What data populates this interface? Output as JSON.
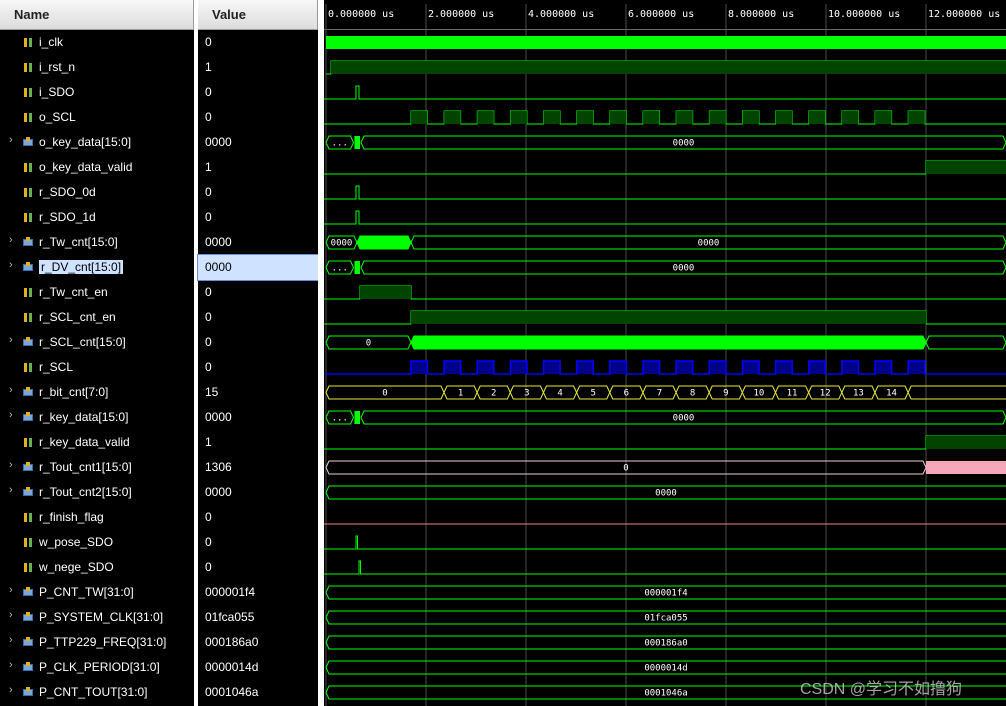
{
  "headers": {
    "name": "Name",
    "value": "Value"
  },
  "signals": [
    {
      "name": "i_clk",
      "value": "0",
      "type": "sig",
      "expand": false
    },
    {
      "name": "i_rst_n",
      "value": "1",
      "type": "sig",
      "expand": false
    },
    {
      "name": "i_SDO",
      "value": "0",
      "type": "sig",
      "expand": false
    },
    {
      "name": "o_SCL",
      "value": "0",
      "type": "sig",
      "expand": false
    },
    {
      "name": "o_key_data[15:0]",
      "value": "0000",
      "type": "bus",
      "expand": true
    },
    {
      "name": "o_key_data_valid",
      "value": "1",
      "type": "sig",
      "expand": false
    },
    {
      "name": "r_SDO_0d",
      "value": "0",
      "type": "sig",
      "expand": false
    },
    {
      "name": "r_SDO_1d",
      "value": "0",
      "type": "sig",
      "expand": false
    },
    {
      "name": "r_Tw_cnt[15:0]",
      "value": "0000",
      "type": "bus",
      "expand": true
    },
    {
      "name": "r_DV_cnt[15:0]",
      "value": "0000",
      "type": "bus",
      "expand": true,
      "selected": true
    },
    {
      "name": "r_Tw_cnt_en",
      "value": "0",
      "type": "sig",
      "expand": false
    },
    {
      "name": "r_SCL_cnt_en",
      "value": "0",
      "type": "sig",
      "expand": false
    },
    {
      "name": "r_SCL_cnt[15:0]",
      "value": "0",
      "type": "bus",
      "expand": true
    },
    {
      "name": "r_SCL",
      "value": "0",
      "type": "sig",
      "expand": false
    },
    {
      "name": "r_bit_cnt[7:0]",
      "value": "15",
      "type": "bus",
      "expand": true
    },
    {
      "name": "r_key_data[15:0]",
      "value": "0000",
      "type": "bus",
      "expand": true
    },
    {
      "name": "r_key_data_valid",
      "value": "1",
      "type": "sig",
      "expand": false
    },
    {
      "name": "r_Tout_cnt1[15:0]",
      "value": "1306",
      "type": "bus",
      "expand": true
    },
    {
      "name": "r_Tout_cnt2[15:0]",
      "value": "0000",
      "type": "bus",
      "expand": true
    },
    {
      "name": "r_finish_flag",
      "value": "0",
      "type": "sig",
      "expand": false
    },
    {
      "name": "w_pose_SDO",
      "value": "0",
      "type": "sig",
      "expand": false
    },
    {
      "name": "w_nege_SDO",
      "value": "0",
      "type": "sig",
      "expand": false
    },
    {
      "name": "P_CNT_TW[31:0]",
      "value": "000001f4",
      "type": "bus",
      "expand": true
    },
    {
      "name": "P_SYSTEM_CLK[31:0]",
      "value": "01fca055",
      "type": "bus",
      "expand": true
    },
    {
      "name": "P_TTP229_FREQ[31:0]",
      "value": "000186a0",
      "type": "bus",
      "expand": true
    },
    {
      "name": "P_CLK_PERIOD[31:0]",
      "value": "0000014d",
      "type": "bus",
      "expand": true
    },
    {
      "name": "P_CNT_TOUT[31:0]",
      "value": "0001046a",
      "type": "bus",
      "expand": true
    }
  ],
  "time_axis": {
    "unit": "us",
    "labels": [
      "0.000000 us",
      "2.000000 us",
      "4.000000 us",
      "6.000000 us",
      "8.000000 us",
      "10.000000 us",
      "12.000000 us"
    ],
    "view_end_us": 13.6
  },
  "waves": {
    "o_key_data_bus": {
      "segs": [
        {
          "t0": 0,
          "t1": 0.55,
          "v": "..."
        },
        {
          "t0": 0.7,
          "t1": 13.6,
          "v": "0000"
        }
      ],
      "pulse": [
        0.55,
        0.7
      ]
    },
    "r_Tw_cnt_bus": {
      "segs": [
        {
          "t0": 0,
          "t1": 0.62,
          "v": "0000"
        },
        {
          "t0": 1.7,
          "t1": 13.6,
          "v": "0000"
        }
      ],
      "fill": [
        0.62,
        1.7
      ]
    },
    "r_DV_cnt_bus": {
      "segs": [
        {
          "t0": 0,
          "t1": 0.55,
          "v": "..."
        },
        {
          "t0": 0.7,
          "t1": 13.6,
          "v": "0000"
        }
      ],
      "pulse": [
        0.55,
        0.7
      ]
    },
    "r_SCL_cnt_bus": {
      "segs": [
        {
          "t0": 0,
          "t1": 1.7,
          "v": "0"
        },
        {
          "t0": 12.0,
          "t1": 13.6,
          "v": ""
        }
      ],
      "fill": [
        1.7,
        12.0
      ]
    },
    "r_bit_cnt_bus": [
      "0",
      "1",
      "2",
      "3",
      "4",
      "5",
      "6",
      "7",
      "8",
      "9",
      "10",
      "11",
      "12",
      "13",
      "14"
    ],
    "r_key_data_bus": {
      "segs": [
        {
          "t0": 0,
          "t1": 0.55,
          "v": "..."
        },
        {
          "t0": 0.7,
          "t1": 13.6,
          "v": "0000"
        }
      ],
      "pulse": [
        0.55,
        0.7
      ]
    },
    "r_Tout_cnt1_bus": {
      "segs": [
        {
          "t0": 0,
          "t1": 12.0,
          "v": "0"
        }
      ],
      "pink": [
        12.0,
        13.6
      ]
    },
    "r_Tout_cnt2_bus": {
      "v": "0000"
    },
    "P_CNT_TW_bus": {
      "v": "000001f4"
    },
    "P_SYSTEM_CLK_bus": {
      "v": "01fca055"
    },
    "P_TTP229_FREQ_bus": {
      "v": "000186a0"
    },
    "P_CLK_PERIOD_bus": {
      "v": "0000014d"
    },
    "P_CNT_TOUT_bus": {
      "v": "0001046a"
    }
  },
  "colors": {
    "green": "#00ff00",
    "dark_green": "#00aa00",
    "blue": "#0000ff",
    "pink": "#f7a8b8",
    "grid": "#006600"
  },
  "watermark": "CSDN @学习不如撸狗"
}
